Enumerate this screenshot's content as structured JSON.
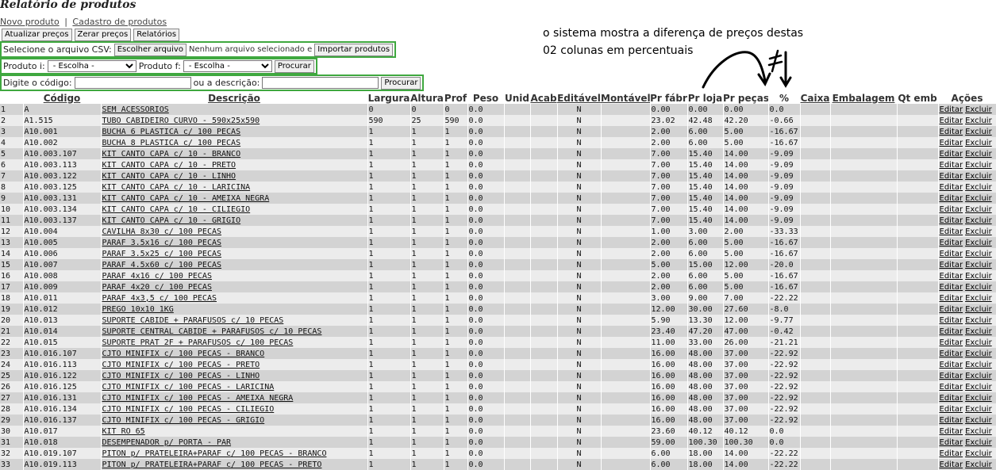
{
  "page": {
    "title": "Relatório de produtos"
  },
  "nav": {
    "new_product": "Novo produto",
    "separator": "|",
    "register": "Cadastro de produtos"
  },
  "toolbar": {
    "update_prices": "Atualizar preços",
    "reset_prices": "Zerar preços",
    "reports": "Relatórios"
  },
  "csv": {
    "label": "Selecione o arquivo CSV:",
    "choose": "Escolher arquivo",
    "no_file": "Nenhum arquivo selecionado e",
    "import": "Importar produtos"
  },
  "filter": {
    "product_i": "Produto i:",
    "product_f": "Produto f:",
    "select_i": "- Escolha -",
    "select_f": "- Escolha -",
    "search": "Procurar"
  },
  "search": {
    "code_label": "Digite o código:",
    "or_desc": "ou a descrição:",
    "search": "Procurar"
  },
  "annotation": {
    "line1": "o sistema mostra a diferença de preços destas",
    "line2": "02 colunas em percentuais"
  },
  "table": {
    "headers": [
      "",
      "Código",
      "Descrição",
      "Largura",
      "Altura",
      "Prof",
      "Peso",
      "Unid",
      "Acab",
      "Editável",
      "Montável",
      "Pr fábr",
      "Pr loja",
      "Pr peças",
      "%",
      "Caixa",
      "Embalagem",
      "Qt emb",
      "Ações"
    ],
    "edit": "Editar",
    "delete": "Excluir",
    "rows": [
      [
        "1",
        "A",
        "SEM ACESSORIOS",
        "0",
        "0",
        "0",
        "0.0",
        "",
        "",
        "N",
        "",
        "0.00",
        "0.00",
        "0.00",
        "0.0"
      ],
      [
        "2",
        "A1.515",
        "TUBO CABIDEIRO CURVO - 590x25x590",
        "590",
        "25",
        "590",
        "0.0",
        "",
        "",
        "N",
        "",
        "23.02",
        "42.48",
        "42.20",
        "-0.66"
      ],
      [
        "3",
        "A10.001",
        "BUCHA 6 PLASTICA c/ 100 PECAS",
        "1",
        "1",
        "1",
        "0.0",
        "",
        "",
        "N",
        "",
        "2.00",
        "6.00",
        "5.00",
        "-16.67"
      ],
      [
        "4",
        "A10.002",
        "BUCHA 8 PLASTICA c/ 100 PECAS",
        "1",
        "1",
        "1",
        "0.0",
        "",
        "",
        "N",
        "",
        "2.00",
        "6.00",
        "5.00",
        "-16.67"
      ],
      [
        "5",
        "A10.003.107",
        "KIT CANTO CAPA c/ 10 - BRANCO",
        "1",
        "1",
        "1",
        "0.0",
        "",
        "",
        "N",
        "",
        "7.00",
        "15.40",
        "14.00",
        "-9.09"
      ],
      [
        "6",
        "A10.003.113",
        "KIT CANTO CAPA c/ 10 - PRETO",
        "1",
        "1",
        "1",
        "0.0",
        "",
        "",
        "N",
        "",
        "7.00",
        "15.40",
        "14.00",
        "-9.09"
      ],
      [
        "7",
        "A10.003.122",
        "KIT CANTO CAPA c/ 10 - LINHO",
        "1",
        "1",
        "1",
        "0.0",
        "",
        "",
        "N",
        "",
        "7.00",
        "15.40",
        "14.00",
        "-9.09"
      ],
      [
        "8",
        "A10.003.125",
        "KIT CANTO CAPA c/ 10 - LARICINA",
        "1",
        "1",
        "1",
        "0.0",
        "",
        "",
        "N",
        "",
        "7.00",
        "15.40",
        "14.00",
        "-9.09"
      ],
      [
        "9",
        "A10.003.131",
        "KIT CANTO CAPA c/ 10 - AMEIXA NEGRA",
        "1",
        "1",
        "1",
        "0.0",
        "",
        "",
        "N",
        "",
        "7.00",
        "15.40",
        "14.00",
        "-9.09"
      ],
      [
        "10",
        "A10.003.134",
        "KIT CANTO CAPA c/ 10 - CILIEGIO",
        "1",
        "1",
        "1",
        "0.0",
        "",
        "",
        "N",
        "",
        "7.00",
        "15.40",
        "14.00",
        "-9.09"
      ],
      [
        "11",
        "A10.003.137",
        "KIT CANTO CAPA c/ 10 - GRIGIO",
        "1",
        "1",
        "1",
        "0.0",
        "",
        "",
        "N",
        "",
        "7.00",
        "15.40",
        "14.00",
        "-9.09"
      ],
      [
        "12",
        "A10.004",
        "CAVILHA 8x30 c/ 100 PECAS",
        "1",
        "1",
        "1",
        "0.0",
        "",
        "",
        "N",
        "",
        "1.00",
        "3.00",
        "2.00",
        "-33.33"
      ],
      [
        "13",
        "A10.005",
        "PARAF 3.5x16 c/ 100 PECAS",
        "1",
        "1",
        "1",
        "0.0",
        "",
        "",
        "N",
        "",
        "2.00",
        "6.00",
        "5.00",
        "-16.67"
      ],
      [
        "14",
        "A10.006",
        "PARAF 3.5x25 c/ 100 PECAS",
        "1",
        "1",
        "1",
        "0.0",
        "",
        "",
        "N",
        "",
        "2.00",
        "6.00",
        "5.00",
        "-16.67"
      ],
      [
        "15",
        "A10.007",
        "PARAF 4.5x60 c/ 100 PECAS",
        "1",
        "1",
        "1",
        "0.0",
        "",
        "",
        "N",
        "",
        "5.00",
        "15.00",
        "12.00",
        "-20.0"
      ],
      [
        "16",
        "A10.008",
        "PARAF 4x16 c/ 100 PECAS",
        "1",
        "1",
        "1",
        "0.0",
        "",
        "",
        "N",
        "",
        "2.00",
        "6.00",
        "5.00",
        "-16.67"
      ],
      [
        "17",
        "A10.009",
        "PARAF 4x20 c/ 100 PECAS",
        "1",
        "1",
        "1",
        "0.0",
        "",
        "",
        "N",
        "",
        "2.00",
        "6.00",
        "5.00",
        "-16.67"
      ],
      [
        "18",
        "A10.011",
        "PARAF 4x3,5 c/ 100 PECAS",
        "1",
        "1",
        "1",
        "0.0",
        "",
        "",
        "N",
        "",
        "3.00",
        "9.00",
        "7.00",
        "-22.22"
      ],
      [
        "19",
        "A10.012",
        "PREGO 10x10 1KG",
        "1",
        "1",
        "1",
        "0.0",
        "",
        "",
        "N",
        "",
        "12.00",
        "30.00",
        "27.60",
        "-8.0"
      ],
      [
        "20",
        "A10.013",
        "SUPORTE CABIDE + PARAFUSOS c/ 10 PECAS",
        "1",
        "1",
        "1",
        "0.0",
        "",
        "",
        "N",
        "",
        "5.90",
        "13.30",
        "12.00",
        "-9.77"
      ],
      [
        "21",
        "A10.014",
        "SUPORTE CENTRAL CABIDE + PARAFUSOS c/ 10 PECAS",
        "1",
        "1",
        "1",
        "0.0",
        "",
        "",
        "N",
        "",
        "23.40",
        "47.20",
        "47.00",
        "-0.42"
      ],
      [
        "22",
        "A10.015",
        "SUPORTE PRAT 2F + PARAFUSOS c/ 100 PECAS",
        "1",
        "1",
        "1",
        "0.0",
        "",
        "",
        "N",
        "",
        "11.00",
        "33.00",
        "26.00",
        "-21.21"
      ],
      [
        "23",
        "A10.016.107",
        "CJTO MINIFIX c/ 100 PECAS - BRANCO",
        "1",
        "1",
        "1",
        "0.0",
        "",
        "",
        "N",
        "",
        "16.00",
        "48.00",
        "37.00",
        "-22.92"
      ],
      [
        "24",
        "A10.016.113",
        "CJTO MINIFIX c/ 100 PECAS - PRETO",
        "1",
        "1",
        "1",
        "0.0",
        "",
        "",
        "N",
        "",
        "16.00",
        "48.00",
        "37.00",
        "-22.92"
      ],
      [
        "25",
        "A10.016.122",
        "CJTO MINIFIX c/ 100 PECAS - LINHO",
        "1",
        "1",
        "1",
        "0.0",
        "",
        "",
        "N",
        "",
        "16.00",
        "48.00",
        "37.00",
        "-22.92"
      ],
      [
        "26",
        "A10.016.125",
        "CJTO MINIFIX c/ 100 PECAS - LARICINA",
        "1",
        "1",
        "1",
        "0.0",
        "",
        "",
        "N",
        "",
        "16.00",
        "48.00",
        "37.00",
        "-22.92"
      ],
      [
        "27",
        "A10.016.131",
        "CJTO MINIFIX c/ 100 PECAS - AMEIXA NEGRA",
        "1",
        "1",
        "1",
        "0.0",
        "",
        "",
        "N",
        "",
        "16.00",
        "48.00",
        "37.00",
        "-22.92"
      ],
      [
        "28",
        "A10.016.134",
        "CJTO MINIFIX c/ 100 PECAS - CILIEGIO",
        "1",
        "1",
        "1",
        "0.0",
        "",
        "",
        "N",
        "",
        "16.00",
        "48.00",
        "37.00",
        "-22.92"
      ],
      [
        "29",
        "A10.016.137",
        "CJTO MINIFIX c/ 100 PECAS - GRIGIO",
        "1",
        "1",
        "1",
        "0.0",
        "",
        "",
        "N",
        "",
        "16.00",
        "48.00",
        "37.00",
        "-22.92"
      ],
      [
        "30",
        "A10.017",
        "KIT RO 65",
        "1",
        "1",
        "1",
        "0.0",
        "",
        "",
        "N",
        "",
        "23.60",
        "40.12",
        "40.12",
        "0.0"
      ],
      [
        "31",
        "A10.018",
        "DESEMPENADOR p/ PORTA - PAR",
        "1",
        "1",
        "1",
        "0.0",
        "",
        "",
        "N",
        "",
        "59.00",
        "100.30",
        "100.30",
        "0.0"
      ],
      [
        "32",
        "A10.019.107",
        "PITON p/ PRATELEIRA+PARAF c/ 100 PECAS - BRANCO",
        "1",
        "1",
        "1",
        "0.0",
        "",
        "",
        "N",
        "",
        "6.00",
        "18.00",
        "14.00",
        "-22.22"
      ],
      [
        "33",
        "A10.019.113",
        "PITON p/ PRATELEIRA+PARAF c/ 100 PECAS - PRETO",
        "1",
        "1",
        "1",
        "0.0",
        "",
        "",
        "N",
        "",
        "6.00",
        "18.00",
        "14.00",
        "-22.22"
      ]
    ]
  }
}
